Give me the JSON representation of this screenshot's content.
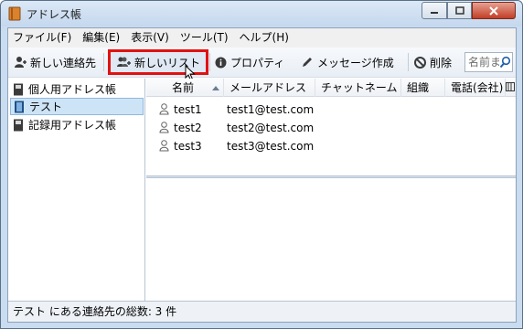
{
  "window": {
    "title": "アドレス帳"
  },
  "menubar": {
    "items": [
      "ファイル(F)",
      "編集(E)",
      "表示(V)",
      "ツール(T)",
      "ヘルプ(H)"
    ]
  },
  "toolbar": {
    "new_contact_label": "新しい連絡先",
    "new_list_label": "新しいリスト",
    "properties_label": "プロパティ",
    "compose_label": "メッセージ作成",
    "delete_label": "削除",
    "search_placeholder": "名前ま",
    "highlight_color": "#e11212"
  },
  "sidebar": {
    "books": [
      {
        "label": "個人用アドレス帳",
        "icon": "address-book-icon",
        "selected": false
      },
      {
        "label": "テスト",
        "icon": "mailing-list-icon",
        "selected": true
      },
      {
        "label": "記録用アドレス帳",
        "icon": "address-book-icon",
        "selected": false
      }
    ]
  },
  "columns": {
    "name": "名前",
    "email": "メールアドレス",
    "chat": "チャットネーム",
    "org": "組織",
    "phone": "電話(会社)"
  },
  "contacts": [
    {
      "name": "test1",
      "email": "test1@test.com"
    },
    {
      "name": "test2",
      "email": "test2@test.com"
    },
    {
      "name": "test3",
      "email": "test3@test.com"
    }
  ],
  "status": {
    "text": "テスト にある連絡先の総数: 3 件"
  }
}
